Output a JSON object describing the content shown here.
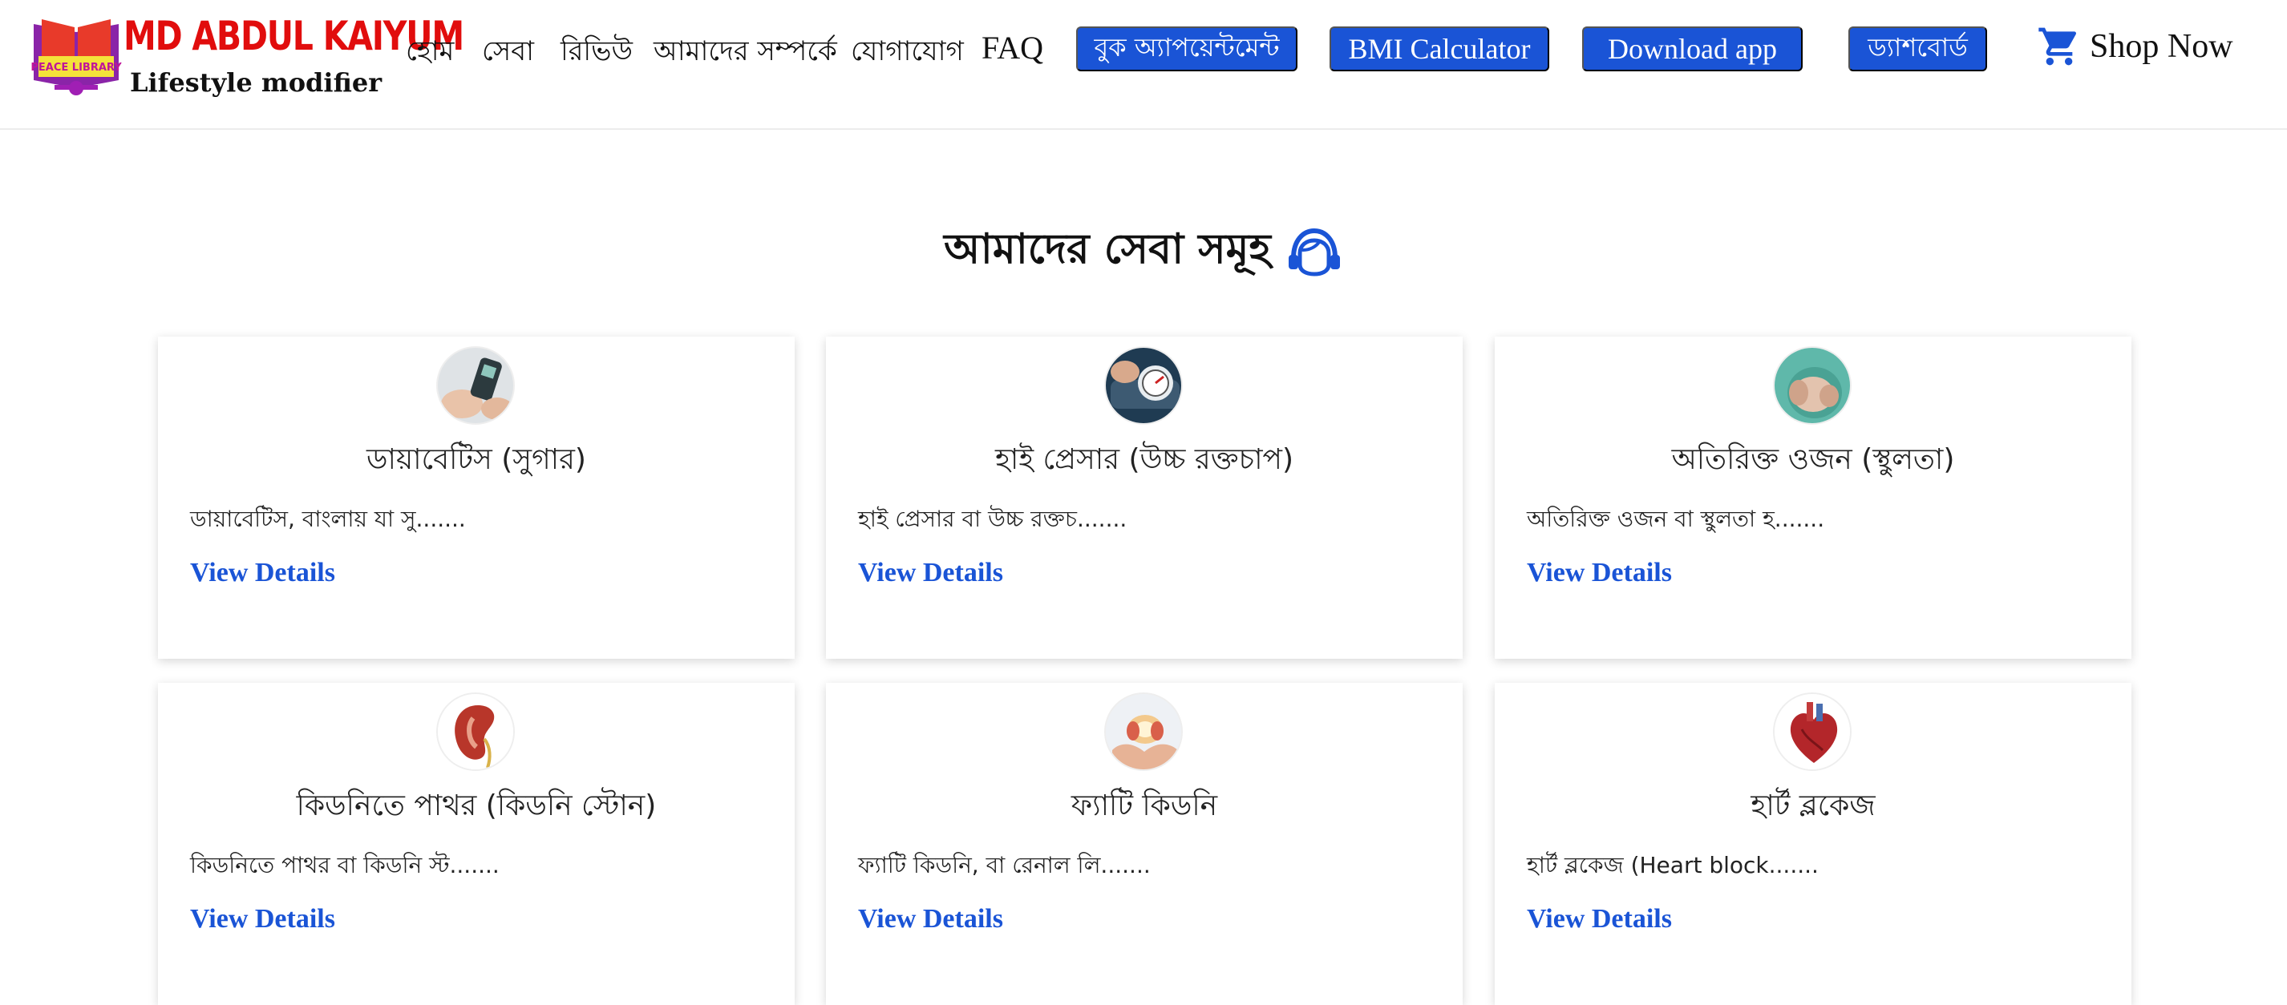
{
  "brand": {
    "badge_text": "PEACE LIBRARY",
    "name": "MD ABDUL KAIYUM",
    "tagline": "Lifestyle modifier"
  },
  "nav": {
    "links": [
      "হোম",
      "সেবা",
      "রিভিউ",
      "আমাদের সম্পর্কে",
      "যোগাযোগ",
      "FAQ"
    ],
    "book_appointment": "বুক অ্যাপয়েন্টমেন্ট",
    "bmi_calculator": "BMI Calculator",
    "download_app": "Download app",
    "dashboard": "ড্যাশবোর্ড",
    "shop": "Shop Now"
  },
  "services": {
    "title": "আমাদের সেবা সমূহ",
    "link_label": "View Details",
    "cards": [
      {
        "title": "ডায়াবেটিস (সুগার)",
        "desc": "ডায়াবেটিস, বাংলায় যা সু.......",
        "icon": "glucose-meter-image"
      },
      {
        "title": "হাই প্রেসার (উচ্চ রক্তচাপ)",
        "desc": "হাই প্রেসার বা উচ্চ রক্তচ.......",
        "icon": "blood-pressure-image"
      },
      {
        "title": "অতিরিক্ত ওজন (স্থুলতা)",
        "desc": "অতিরিক্ত ওজন বা স্থুলতা হ.......",
        "icon": "belly-image"
      },
      {
        "title": "কিডনিতে পাথর (কিডনি স্টোন)",
        "desc": "কিডনিতে পাথর বা কিডনি স্ট.......",
        "icon": "kidney-image"
      },
      {
        "title": "ফ্যাটি কিডনি",
        "desc": "ফ্যাটি কিডনি, বা রেনাল লি.......",
        "icon": "hands-kidney-image"
      },
      {
        "title": "হার্ট ব্লকেজ",
        "desc": "হার্ট ব্লকেজ (Heart block.......",
        "icon": "heart-image"
      }
    ]
  },
  "colors": {
    "accent": "#1a54d6",
    "brand_red": "#e10d0d",
    "logo_purple": "#8a24a8",
    "logo_yellow": "#f4e23a"
  }
}
